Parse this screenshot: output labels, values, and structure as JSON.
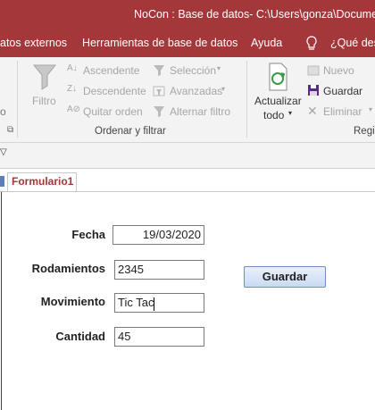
{
  "titlebar": {
    "text": "NoCon : Base de datos- C:\\Users\\gonza\\Documents"
  },
  "menubar": {
    "items": [
      "atos externos",
      "Herramientas de base de datos",
      "Ayuda",
      "¿Qué des"
    ]
  },
  "ribbon": {
    "filter": {
      "filtro": "Filtro",
      "ascendente": "Ascendente",
      "descendente": "Descendente",
      "quitar_orden": "Quitar orden",
      "seleccion": "Selección",
      "avanzadas": "Avanzadas",
      "alternar_filtro": "Alternar filtro",
      "group_label": "Ordenar y filtrar"
    },
    "records": {
      "actualizar": "Actualizar",
      "todo": "todo",
      "nuevo": "Nuevo",
      "guardar": "Guardar",
      "eliminar": "Eliminar",
      "group_label": "Regi"
    }
  },
  "tab": {
    "label": "Formulario1"
  },
  "form": {
    "fields": [
      {
        "label": "Fecha",
        "value": "19/03/2020"
      },
      {
        "label": "Rodamientos",
        "value": "2345"
      },
      {
        "label": "Movimiento",
        "value": "Tic Tac"
      },
      {
        "label": "Cantidad",
        "value": "45"
      }
    ],
    "save_button": "Guardar"
  },
  "colors": {
    "accent": "#a4373a",
    "button": "#c9daf1"
  }
}
